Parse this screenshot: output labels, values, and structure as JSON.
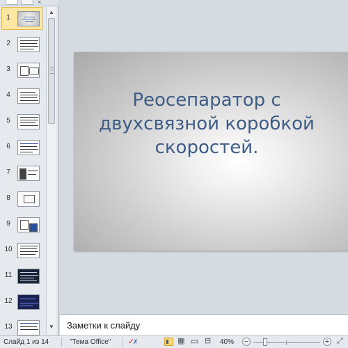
{
  "thumbnails": [
    "1",
    "2",
    "3",
    "4",
    "5",
    "6",
    "7",
    "8",
    "9",
    "10",
    "11",
    "12",
    "13"
  ],
  "selected_slide": 1,
  "slide": {
    "title_lines": [
      "Реосепаратор с",
      "двухсвязной коробкой",
      "скоростей."
    ]
  },
  "notes": {
    "placeholder": "Заметки к слайду"
  },
  "status": {
    "slide_counter": "Слайд 1 из 14",
    "theme": "\"Тема Office\"",
    "zoom": "40%",
    "zoom_level_fraction": 0.4
  },
  "icons": {
    "spell": "spellcheck-icon",
    "normal": "normal-view-icon",
    "sorter": "slide-sorter-icon",
    "reading": "reading-view-icon",
    "slideshow": "slideshow-icon",
    "fit": "fit-to-window-icon"
  },
  "colors": {
    "title": "#3e5d86",
    "selection": "#fde7a2"
  }
}
